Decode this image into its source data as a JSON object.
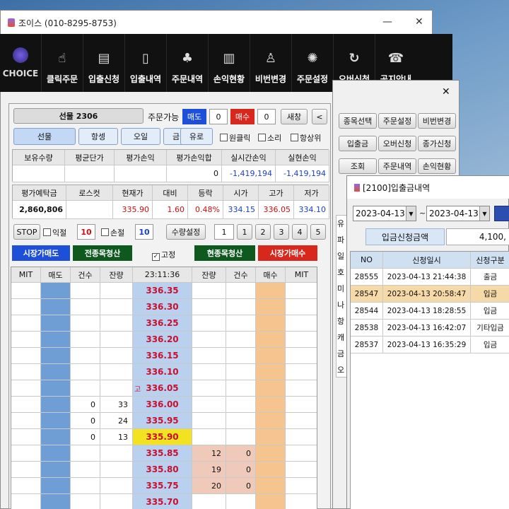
{
  "main_window": {
    "title": "조이스 (010-8295-8753)",
    "minimize": "—",
    "close": "✕"
  },
  "toolbar": {
    "brand": "CHOICE",
    "items": [
      {
        "label": "클릭주문",
        "icon": "hand-click-icon"
      },
      {
        "label": "입출신청",
        "icon": "document-icon"
      },
      {
        "label": "입출내역",
        "icon": "mobile-icon"
      },
      {
        "label": "주문내역",
        "icon": "people-icon"
      },
      {
        "label": "손익현황",
        "icon": "bar-chart-icon"
      },
      {
        "label": "비번변경",
        "icon": "key-person-icon"
      },
      {
        "label": "주문설정",
        "icon": "gear-icon"
      },
      {
        "label": "오버신청",
        "icon": "refresh-icon"
      },
      {
        "label": "공지안내",
        "icon": "notice-icon"
      }
    ]
  },
  "order": {
    "product": "선물 2306",
    "order_avail": "주문가능",
    "sell": "매도",
    "sell_qty": "0",
    "buy": "매수",
    "buy_qty": "0",
    "more": "새창",
    "back": "<",
    "tabs": [
      "선물",
      "항셍",
      "오일",
      "금",
      "유로"
    ],
    "options": [
      "원클릭",
      "소리",
      "항상위"
    ],
    "pos_headers": [
      "보유수량",
      "평균단가",
      "평가손익",
      "평가손익합",
      "실시간손익",
      "실현손익"
    ],
    "pos_values": [
      "",
      "",
      "",
      "0",
      "-1,419,194",
      "-1,419,194"
    ],
    "eval_headers": [
      "평가예탁금",
      "로스컷",
      "현재가",
      "대비",
      "등락",
      "시가",
      "고가",
      "저가"
    ],
    "eval_values": [
      "2,860,806",
      "",
      "335.90",
      "1.60",
      "0.48%",
      "334.15",
      "336.05",
      "334.10"
    ],
    "stop": "STOP",
    "profit": "익절",
    "profit_val": "10",
    "loss": "손절",
    "loss_val": "10",
    "qty_set": "수량설정",
    "qty_val": "1",
    "qty_btns": [
      "1",
      "2",
      "3",
      "4",
      "5"
    ],
    "market_sell": "시장가매도",
    "close_all": "전종목청산",
    "fixed": "고정",
    "close_current": "현종목청산",
    "market_buy": "시장가매수",
    "book_headers": [
      "MIT",
      "매도",
      "건수",
      "잔량",
      "23:11:36",
      "잔량",
      "건수",
      "매수",
      "MIT"
    ],
    "prices": [
      "336.35",
      "336.30",
      "336.25",
      "336.20",
      "336.15",
      "336.10",
      "336.05",
      "336.00",
      "335.95",
      "335.90",
      "335.85",
      "335.80",
      "335.75",
      "335.70"
    ],
    "high_marker": "고",
    "ask_count": [
      "",
      "",
      "",
      "",
      "",
      "",
      "",
      "0",
      "0",
      "0",
      "",
      "",
      "",
      ""
    ],
    "ask_rem": [
      "",
      "",
      "",
      "",
      "",
      "",
      "",
      "33",
      "24",
      "13",
      "",
      "",
      "",
      ""
    ],
    "bid_rem": [
      "",
      "",
      "",
      "",
      "",
      "",
      "",
      "",
      "",
      "",
      "12",
      "19",
      "20",
      ""
    ],
    "bid_count": [
      "",
      "",
      "",
      "",
      "",
      "",
      "",
      "",
      "",
      "",
      "0",
      "0",
      "0",
      ""
    ]
  },
  "side_menu": {
    "close": "✕",
    "buttons": [
      "종목선택",
      "주문설정",
      "비번변경",
      "입출금",
      "오버신청",
      "종가신청",
      "조회",
      "주문내역",
      "손익현황"
    ],
    "list_items": [
      "유료",
      "파생",
      "일반",
      "호주",
      "미니",
      "나스",
      "항셍",
      "캐나",
      "금리",
      "오일"
    ]
  },
  "history": {
    "title": "[2100]입출금내역",
    "date_from": "2023-04-13",
    "sep": "~",
    "date_to": "2023-04-13",
    "summary_label": "입금신청금액",
    "summary_value": "4,100,",
    "headers": [
      "NO",
      "신청일시",
      "신청구분"
    ],
    "rows": [
      {
        "no": "28555",
        "dt": "2023-04-13 21:44:38",
        "type": "출금"
      },
      {
        "no": "28547",
        "dt": "2023-04-13 20:58:47",
        "type": "입금"
      },
      {
        "no": "28544",
        "dt": "2023-04-13 18:28:55",
        "type": "입금"
      },
      {
        "no": "28538",
        "dt": "2023-04-13 16:42:07",
        "type": "기타입금"
      },
      {
        "no": "28537",
        "dt": "2023-04-13 16:35:29",
        "type": "입금"
      }
    ]
  }
}
